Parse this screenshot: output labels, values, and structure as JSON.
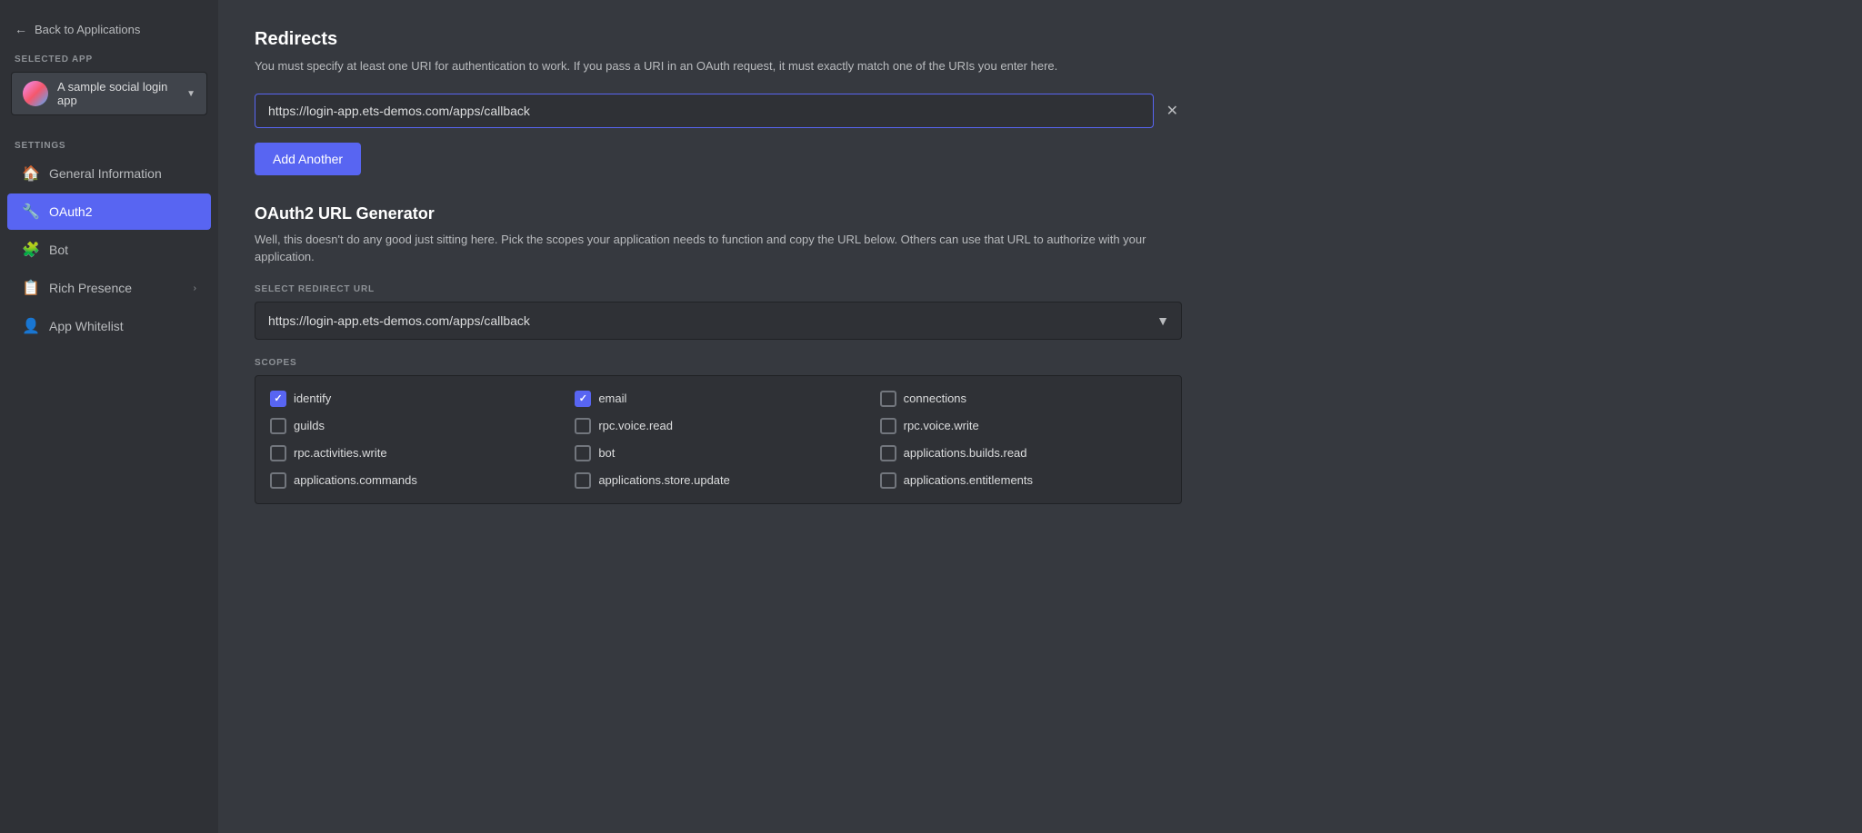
{
  "sidebar": {
    "back_label": "Back to Applications",
    "selected_app_label": "SELECTED APP",
    "app_name": "A sample social login app",
    "settings_label": "SETTINGS",
    "nav_items": [
      {
        "id": "general",
        "label": "General Information",
        "icon": "🏠",
        "active": false,
        "has_chevron": false
      },
      {
        "id": "oauth2",
        "label": "OAuth2",
        "icon": "🔧",
        "active": true,
        "has_chevron": false
      },
      {
        "id": "bot",
        "label": "Bot",
        "icon": "🧩",
        "active": false,
        "has_chevron": false
      },
      {
        "id": "rich-presence",
        "label": "Rich Presence",
        "icon": "📋",
        "active": false,
        "has_chevron": true
      },
      {
        "id": "app-whitelist",
        "label": "App Whitelist",
        "icon": "👤",
        "active": false,
        "has_chevron": false
      }
    ]
  },
  "main": {
    "redirects_title": "Redirects",
    "redirects_desc": "You must specify at least one URI for authentication to work. If you pass a URI in an OAuth request, it must exactly match one of the URIs you enter here.",
    "redirect_input_value": "https://login-app.ets-demos.com/apps/callback",
    "add_another_label": "Add Another",
    "url_gen_title": "OAuth2 URL Generator",
    "url_gen_desc": "Well, this doesn't do any good just sitting here. Pick the scopes your application needs to function and copy the URL below. Others can use that URL to authorize with your application.",
    "select_redirect_label": "SELECT REDIRECT URL",
    "redirect_select_value": "https://login-app.ets-demos.com/apps/callback",
    "scopes_label": "SCOPES",
    "scopes": [
      {
        "id": "identify",
        "label": "identify",
        "checked": true,
        "col": 0
      },
      {
        "id": "email",
        "label": "email",
        "checked": true,
        "col": 0
      },
      {
        "id": "connections",
        "label": "connections",
        "checked": false,
        "col": 0
      },
      {
        "id": "guilds",
        "label": "guilds",
        "checked": false,
        "col": 0
      },
      {
        "id": "rpc-voice-read",
        "label": "rpc.voice.read",
        "checked": false,
        "col": 1
      },
      {
        "id": "rpc-voice-write",
        "label": "rpc.voice.write",
        "checked": false,
        "col": 1
      },
      {
        "id": "rpc-activities-write",
        "label": "rpc.activities.write",
        "checked": false,
        "col": 1
      },
      {
        "id": "bot",
        "label": "bot",
        "checked": false,
        "col": 1
      },
      {
        "id": "applications-builds-read",
        "label": "applications.builds.read",
        "checked": false,
        "col": 2
      },
      {
        "id": "applications-commands",
        "label": "applications.commands",
        "checked": false,
        "col": 2
      },
      {
        "id": "applications-store-update",
        "label": "applications.store.update",
        "checked": false,
        "col": 2
      },
      {
        "id": "applications-entitlements",
        "label": "applications.entitlements",
        "checked": false,
        "col": 2
      }
    ]
  }
}
